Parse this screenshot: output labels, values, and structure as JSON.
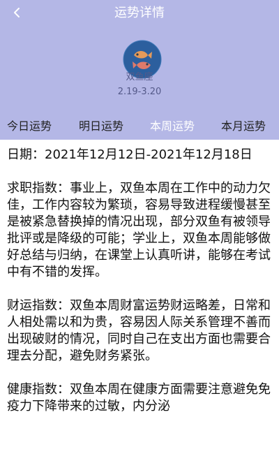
{
  "header": {
    "title": "运势详情",
    "sign_name": "双鱼座",
    "sign_date": "2.19-3.20",
    "bg_color": "#b4b7e6"
  },
  "icons": {
    "back": "chevron-left-icon",
    "avatar": "pisces-fish-icon"
  },
  "tabs": [
    {
      "label": "今日运势",
      "active": false
    },
    {
      "label": "明日运势",
      "active": false
    },
    {
      "label": "本周运势",
      "active": true
    },
    {
      "label": "本月运势",
      "active": false
    }
  ],
  "content": {
    "date_line": "日期：2021年12月12日-2021年12月18日",
    "career": "求职指数：事业上，双鱼本周在工作中的动力欠佳，工作内容较为繁琐，容易导致进程缓慢甚至是被紧急替换掉的情况出现，部分双鱼有被领导批评或是降级的可能；学业上，双鱼本周能够做好总结与归纳，在课堂上认真听讲，能够在考试中有不错的发挥。",
    "wealth": "财运指数：双鱼本周财富运势财运略差，日常和人相处需以和为贵，容易因人际关系管理不善而出现破财的情况，同时自己在支出方面也需要合理去分配，避免财务紧张。",
    "health": "健康指数：双鱼本周在健康方面需要注意避免免疫力下降带来的过敏，内分泌"
  }
}
